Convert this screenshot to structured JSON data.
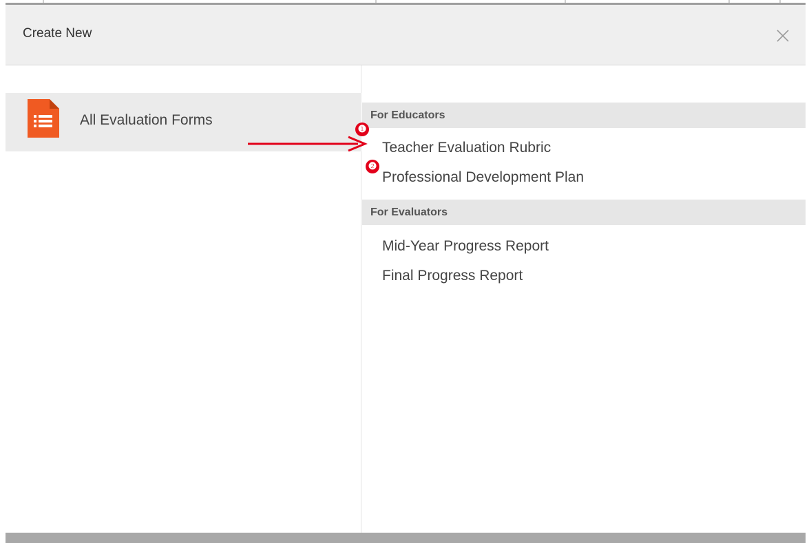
{
  "dialog": {
    "title": "Create New",
    "close_icon": "close-x-icon"
  },
  "sidebar": {
    "items": [
      {
        "label": "All Evaluation Forms",
        "icon": "form-document-icon",
        "icon_color": "#f05a22",
        "selected": true
      }
    ]
  },
  "sections": [
    {
      "header": "For Educators",
      "items": [
        {
          "label": "Teacher Evaluation Rubric"
        },
        {
          "label": "Professional Development Plan"
        }
      ]
    },
    {
      "header": "For Evaluators",
      "items": [
        {
          "label": "Mid-Year Progress Report"
        },
        {
          "label": "Final Progress Report"
        }
      ]
    }
  ],
  "annotations": {
    "badge_1": "❶",
    "badge_2": "❷",
    "accent_color": "#e2001a",
    "arrow_icon": "red-arrow-icon"
  }
}
